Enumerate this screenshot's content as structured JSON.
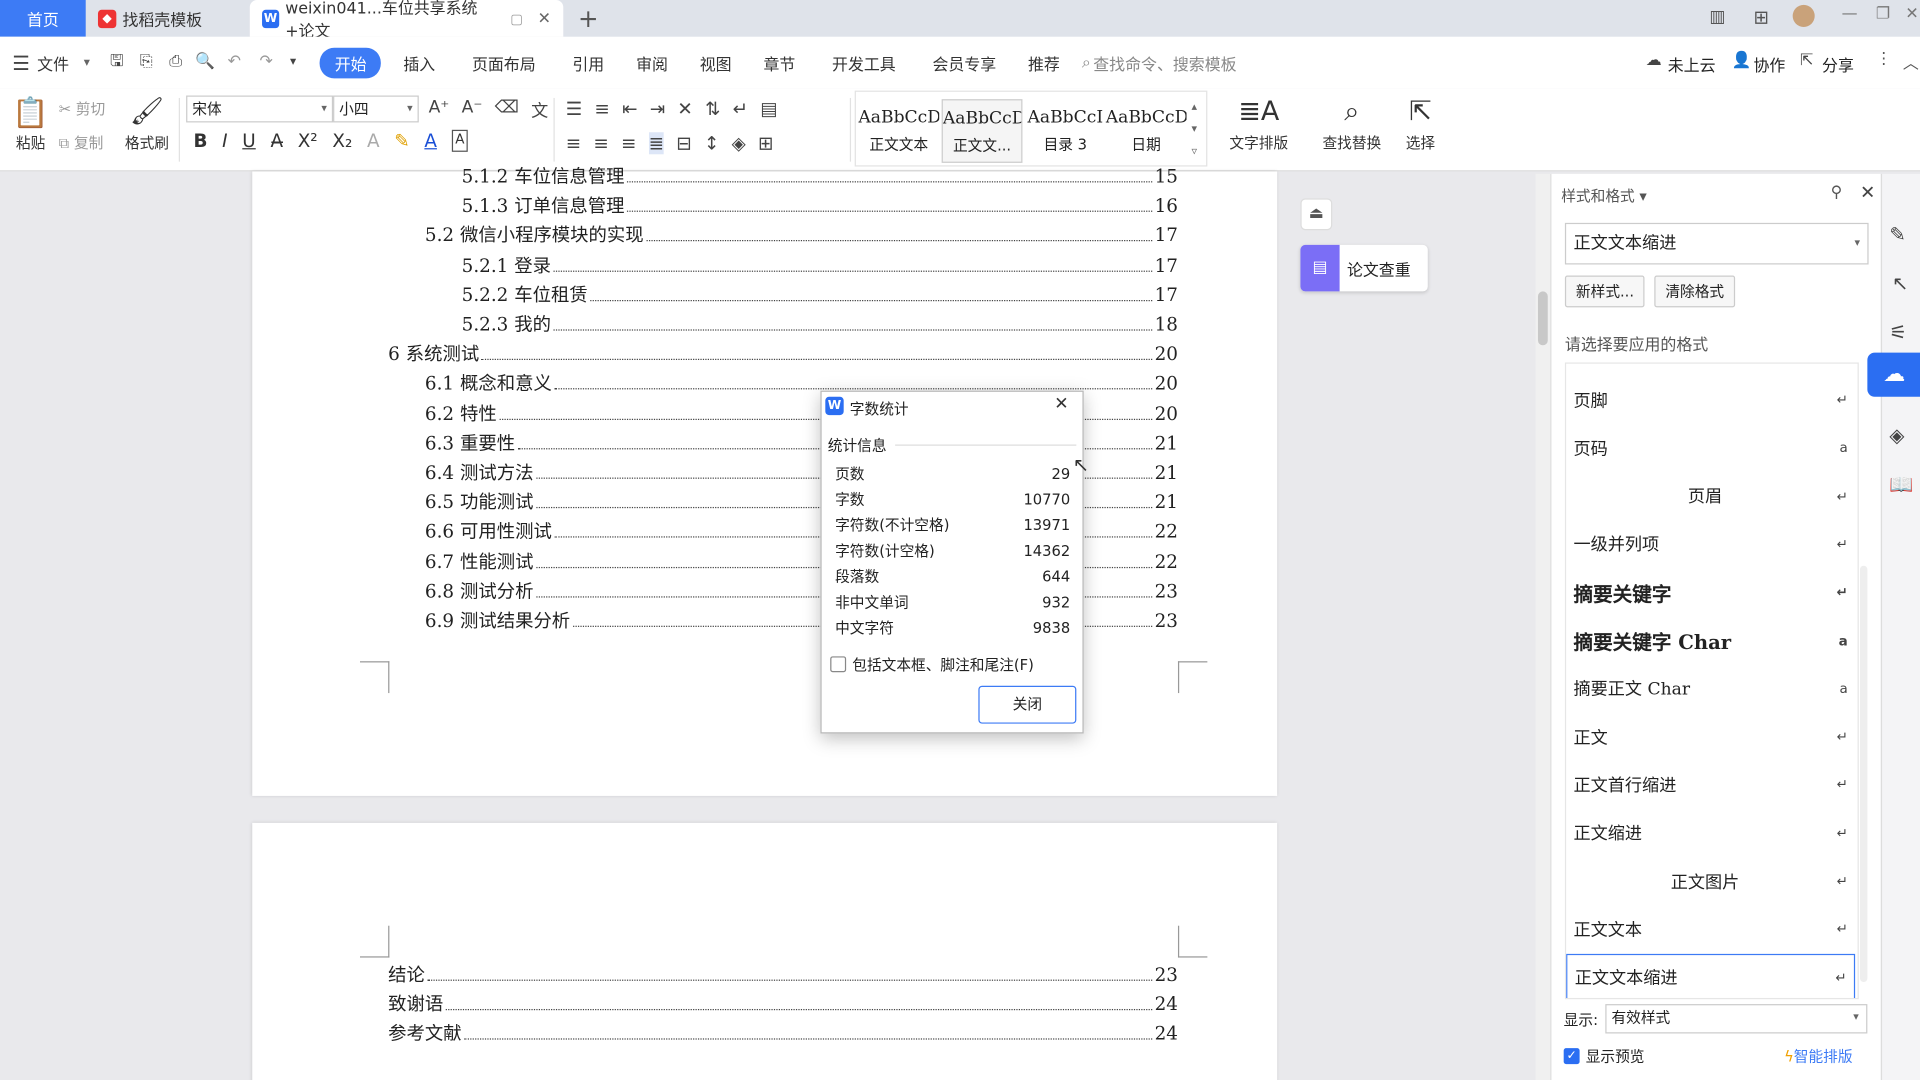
{
  "tabs": {
    "home": "首页",
    "wps": "找稻壳模板",
    "doc": "weixin041...车位共享系统+论文"
  },
  "menu": {
    "file": "文件",
    "items": [
      "开始",
      "插入",
      "页面布局",
      "引用",
      "审阅",
      "视图",
      "章节",
      "开发工具",
      "会员专享",
      "推荐"
    ],
    "search": "查找命令、搜索模板",
    "cloud": "未上云",
    "collab": "协作",
    "share": "分享"
  },
  "ribbon": {
    "paste": "粘贴",
    "cut": "剪切",
    "copy": "复制",
    "format_painter": "格式刷",
    "font": "宋体",
    "size": "小四",
    "styles": [
      {
        "sample": "AaBbCcDd",
        "name": "正文文本"
      },
      {
        "sample": "AaBbCcDd",
        "name": "正文文..."
      },
      {
        "sample": "AaBbCcI",
        "name": "目录 3"
      },
      {
        "sample": "AaBbCcDd",
        "name": "日期"
      }
    ],
    "text_layout": "文字排版",
    "find_replace": "查找替换",
    "select": "选择"
  },
  "toc": [
    {
      "num": "5.1.2",
      "title": "车位信息管理",
      "page": "15",
      "level": 3
    },
    {
      "num": "5.1.3",
      "title": "订单信息管理",
      "page": "16",
      "level": 3
    },
    {
      "num": "5.2",
      "title": "微信小程序模块的实现",
      "page": "17",
      "level": 2
    },
    {
      "num": "5.2.1",
      "title": "登录",
      "page": "17",
      "level": 3
    },
    {
      "num": "5.2.2",
      "title": "车位租赁",
      "page": "17",
      "level": 3
    },
    {
      "num": "5.2.3",
      "title": "我的",
      "page": "18",
      "level": 3
    },
    {
      "num": "6",
      "title": "系统测试",
      "page": "20",
      "level": 1
    },
    {
      "num": "6.1",
      "title": "概念和意义",
      "page": "20",
      "level": 2
    },
    {
      "num": "6.2",
      "title": "特性",
      "page": "20",
      "level": 2
    },
    {
      "num": "6.3",
      "title": "重要性",
      "page": "21",
      "level": 2
    },
    {
      "num": "6.4",
      "title": "测试方法",
      "page": "21",
      "level": 2
    },
    {
      "num": "6.5",
      "title": "功能测试",
      "page": "21",
      "level": 2
    },
    {
      "num": "6.6",
      "title": "可用性测试",
      "page": "22",
      "level": 2
    },
    {
      "num": "6.7",
      "title": "性能测试",
      "page": "22",
      "level": 2
    },
    {
      "num": "6.8",
      "title": "测试分析",
      "page": "23",
      "level": 2
    },
    {
      "num": "6.9",
      "title": "测试结果分析",
      "page": "23",
      "level": 2
    }
  ],
  "toc2": [
    {
      "title": "结论",
      "page": "23"
    },
    {
      "title": "致谢语",
      "page": "24"
    },
    {
      "title": "参考文献",
      "page": "24"
    }
  ],
  "paper_check": "论文查重",
  "dialog": {
    "title": "字数统计",
    "section": "统计信息",
    "rows": [
      {
        "label": "页数",
        "value": "29"
      },
      {
        "label": "字数",
        "value": "10770"
      },
      {
        "label": "字符数(不计空格)",
        "value": "13971"
      },
      {
        "label": "字符数(计空格)",
        "value": "14362"
      },
      {
        "label": "段落数",
        "value": "644"
      },
      {
        "label": "非中文单词",
        "value": "932"
      },
      {
        "label": "中文字符",
        "value": "9838"
      }
    ],
    "checkbox": "包括文本框、脚注和尾注(F)",
    "close": "关闭"
  },
  "panel": {
    "title": "样式和格式",
    "current": "正文文本缩进",
    "new_style": "新样式...",
    "clear": "清除格式",
    "prompt": "请选择要应用的格式",
    "styles": [
      {
        "name": "页脚",
        "mark": "↵"
      },
      {
        "name": "页码",
        "mark": "a"
      },
      {
        "name": "页眉",
        "mark": "↵"
      },
      {
        "name": "一级并列项",
        "mark": "↵"
      },
      {
        "name": "摘要关键字",
        "mark": "↵"
      },
      {
        "name": "摘要关键字 Char",
        "mark": "a"
      },
      {
        "name": "摘要正文 Char",
        "mark": "a"
      },
      {
        "name": "正文",
        "mark": "↵"
      },
      {
        "name": "正文首行缩进",
        "mark": "↵"
      },
      {
        "name": "正文缩进",
        "mark": "↵"
      },
      {
        "name": "正文图片",
        "mark": "↵"
      },
      {
        "name": "正文文本",
        "mark": "↵"
      },
      {
        "name": "正文文本缩进",
        "mark": "↵"
      }
    ],
    "show_label": "显示:",
    "show_value": "有效样式",
    "preview": "显示预览",
    "smart": "智能排版"
  }
}
